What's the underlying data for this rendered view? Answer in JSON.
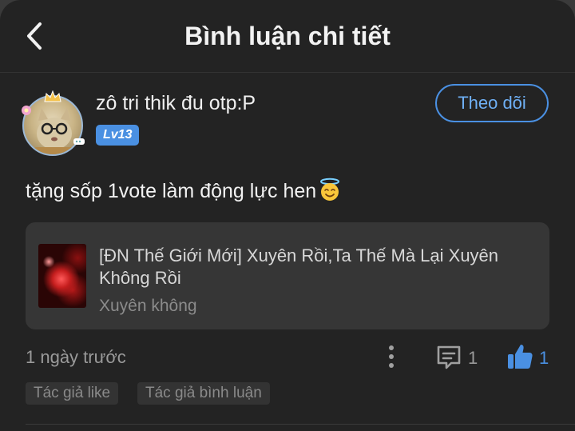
{
  "header": {
    "title": "Bình luận chi tiết"
  },
  "user": {
    "name": "zô tri thik đu otp:P",
    "level": "Lv13",
    "follow_label": "Theo dõi"
  },
  "comment": {
    "text": "tặng sốp 1vote làm động lực hen",
    "emoji": "smiling-face-with-halo-icon"
  },
  "story": {
    "title": "[ĐN Thế Giới Mới] Xuyên Rồi,Ta Thế Mà Lại Xuyên Không Rồi",
    "genre": "Xuyên không"
  },
  "footer": {
    "time_ago": "1 ngày trước",
    "comment_count": "1",
    "like_count": "1"
  },
  "tags": [
    "Tác giả like",
    "Tác giả bình luận"
  ],
  "colors": {
    "accent": "#4a90e2",
    "background": "#232323",
    "card": "#363636"
  }
}
